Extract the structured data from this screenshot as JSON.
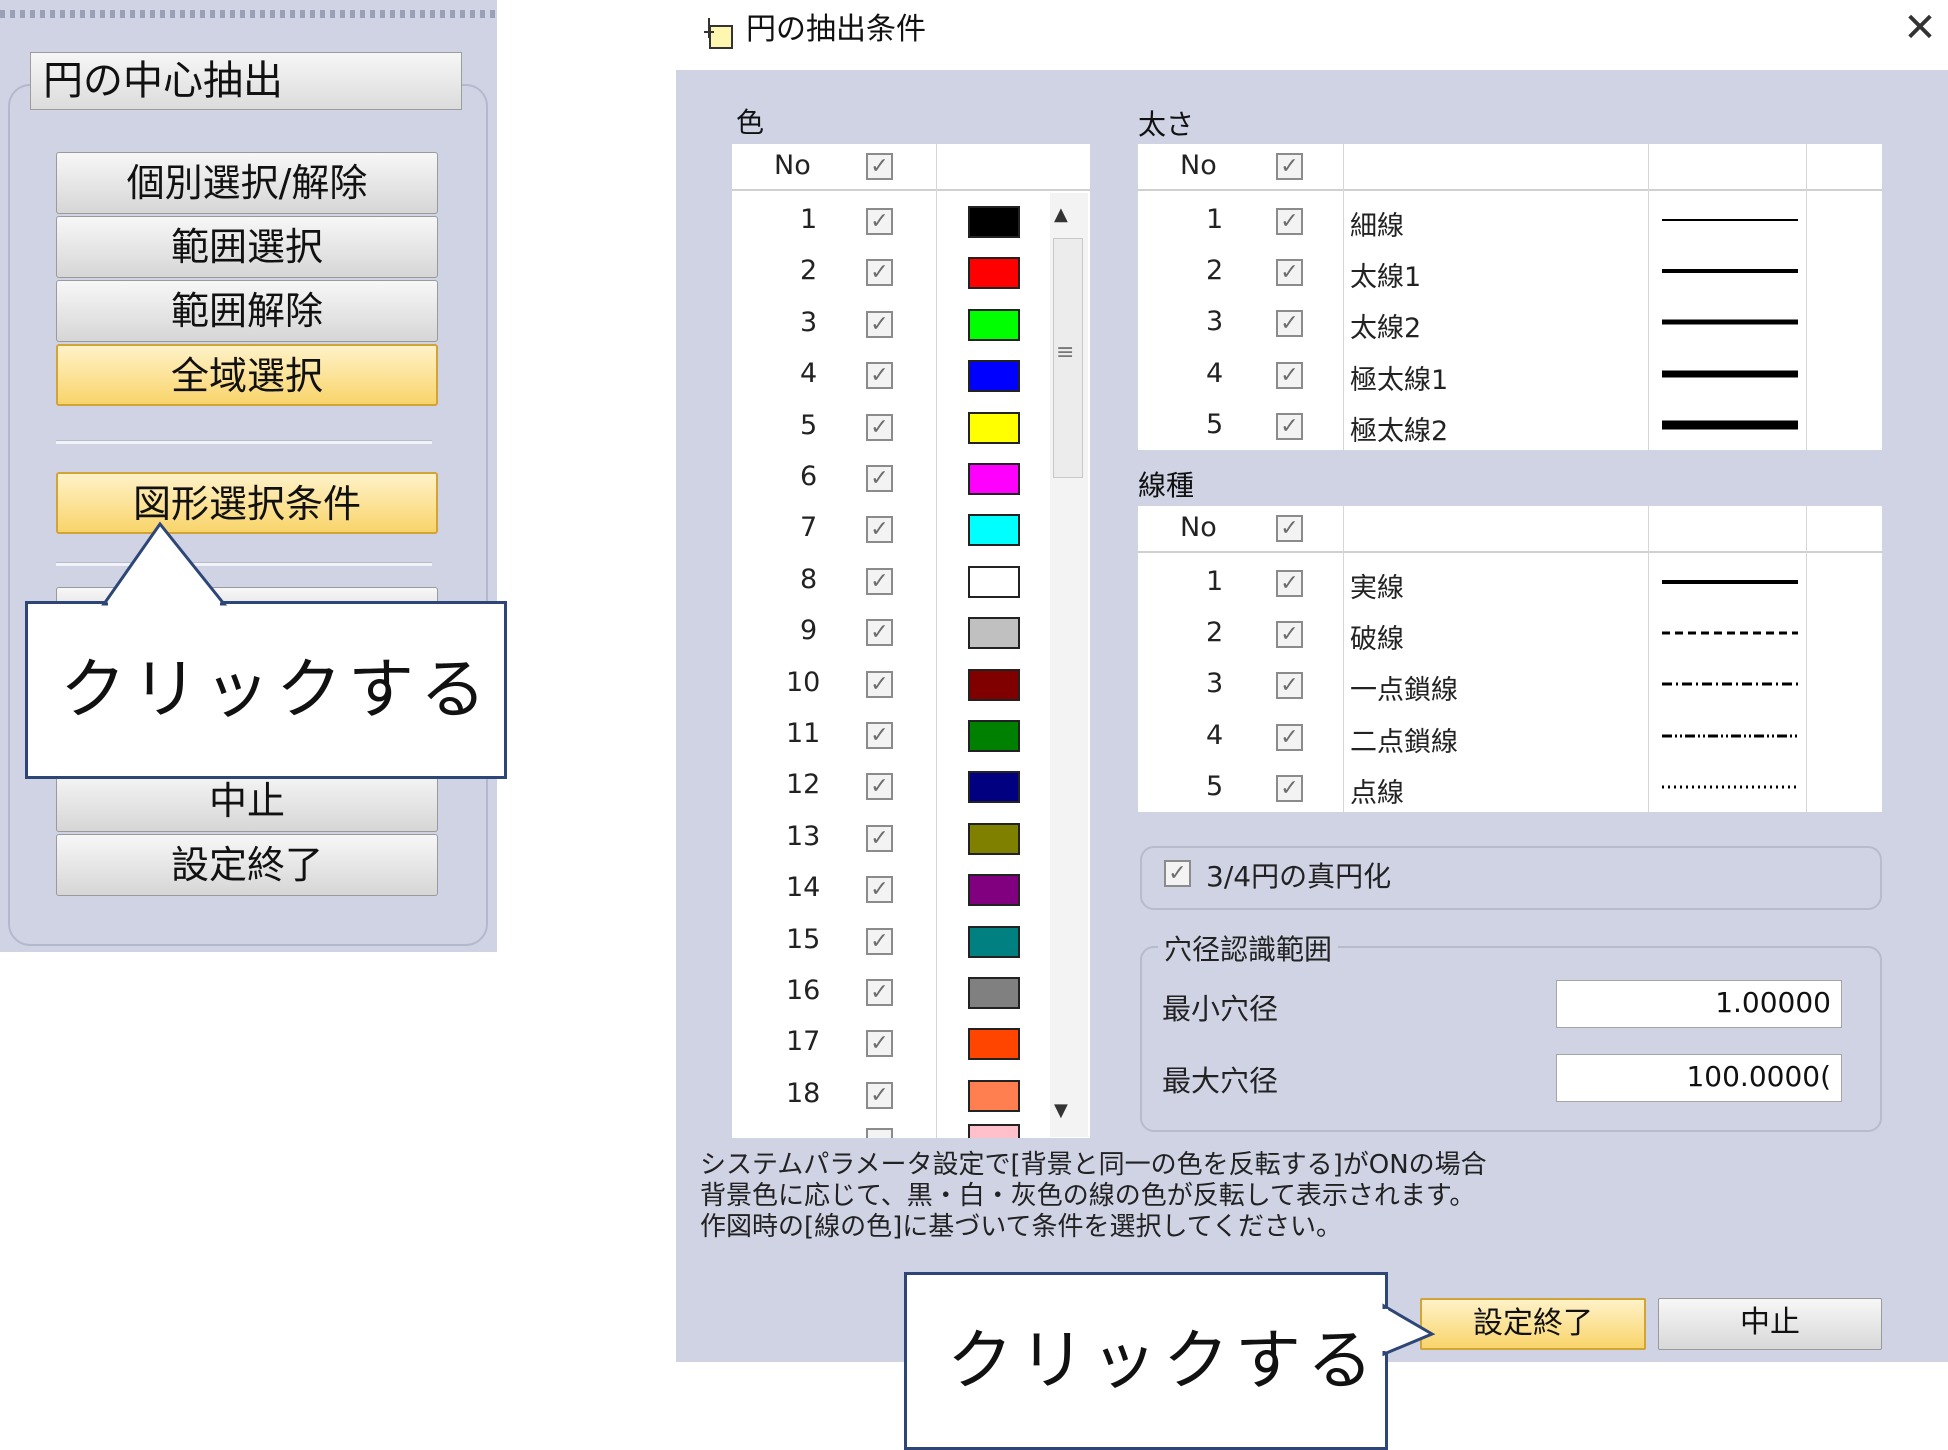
{
  "left_panel": {
    "title": "円の中心抽出",
    "buttons": [
      {
        "label": "個別選択/解除"
      },
      {
        "label": "範囲選択"
      },
      {
        "label": "範囲解除"
      },
      {
        "label": "全域選択"
      },
      {
        "label": "図形選択条件"
      },
      {
        "label": "中止"
      },
      {
        "label": "設定終了"
      }
    ]
  },
  "callouts": {
    "left": "クリックする",
    "bottom": "クリックする"
  },
  "dialog": {
    "title": "円の抽出条件",
    "close": "✕",
    "color_section": {
      "label": "色",
      "header_no": "No",
      "rows": [
        {
          "no": "1",
          "color": "#000000"
        },
        {
          "no": "2",
          "color": "#ff0000"
        },
        {
          "no": "3",
          "color": "#00ff00"
        },
        {
          "no": "4",
          "color": "#0000ff"
        },
        {
          "no": "5",
          "color": "#ffff00"
        },
        {
          "no": "6",
          "color": "#ff00ff"
        },
        {
          "no": "7",
          "color": "#00ffff"
        },
        {
          "no": "8",
          "color": "#ffffff"
        },
        {
          "no": "9",
          "color": "#c0c0c0"
        },
        {
          "no": "10",
          "color": "#800000"
        },
        {
          "no": "11",
          "color": "#008000"
        },
        {
          "no": "12",
          "color": "#000080"
        },
        {
          "no": "13",
          "color": "#808000"
        },
        {
          "no": "14",
          "color": "#800080"
        },
        {
          "no": "15",
          "color": "#008080"
        },
        {
          "no": "16",
          "color": "#808080"
        },
        {
          "no": "17",
          "color": "#ff4500"
        },
        {
          "no": "18",
          "color": "#ff7f50"
        }
      ]
    },
    "thickness_section": {
      "label": "太さ",
      "header_no": "No",
      "rows": [
        {
          "no": "1",
          "name": "細線"
        },
        {
          "no": "2",
          "name": "太線1"
        },
        {
          "no": "3",
          "name": "太線2"
        },
        {
          "no": "4",
          "name": "極太線1"
        },
        {
          "no": "5",
          "name": "極太線2"
        }
      ]
    },
    "linetype_section": {
      "label": "線種",
      "header_no": "No",
      "rows": [
        {
          "no": "1",
          "name": "実線"
        },
        {
          "no": "2",
          "name": "破線"
        },
        {
          "no": "3",
          "name": "一点鎖線"
        },
        {
          "no": "4",
          "name": "二点鎖線"
        },
        {
          "no": "5",
          "name": "点線"
        }
      ]
    },
    "round_option": {
      "label": "3/4円の真円化",
      "checked": true
    },
    "hole_range": {
      "label": "穴径認識範囲",
      "min_label": "最小穴径",
      "min_value": "1.00000",
      "max_label": "最大穴径",
      "max_value": "100.0000("
    },
    "note_lines": [
      "システムパラメータ設定で[背景と同一の色を反転する]がONの場合",
      "背景色に応じて、黒・白・灰色の線の色が反転して表示されます。",
      "作図時の[線の色]に基づいて条件を選択してください。"
    ],
    "ok_button": "設定終了",
    "cancel_button": "中止",
    "check_glyph": "✓",
    "scroll_up": "▲",
    "scroll_down": "▼",
    "scroll_grip": "≡"
  }
}
